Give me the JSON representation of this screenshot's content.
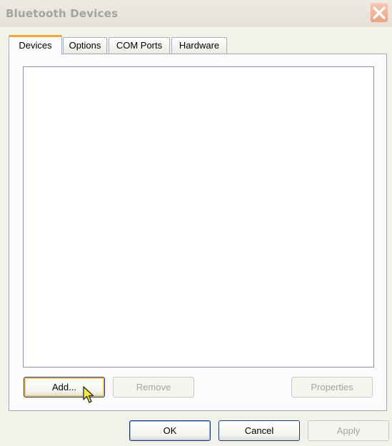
{
  "window": {
    "title": "Bluetooth Devices"
  },
  "tabs": [
    {
      "label": "Devices",
      "active": true
    },
    {
      "label": "Options",
      "active": false
    },
    {
      "label": "COM Ports",
      "active": false
    },
    {
      "label": "Hardware",
      "active": false
    }
  ],
  "devices": {
    "items": []
  },
  "device_buttons": {
    "add": "Add...",
    "remove": "Remove",
    "properties": "Properties"
  },
  "dialog_buttons": {
    "ok": "OK",
    "cancel": "Cancel",
    "apply": "Apply"
  },
  "icons": {
    "close": "close-icon",
    "cursor": "mouse-pointer-icon"
  },
  "colors": {
    "active_tab_accent": "#f0a833",
    "close_button": "#e8a586",
    "title_text": "#a2a49e"
  }
}
